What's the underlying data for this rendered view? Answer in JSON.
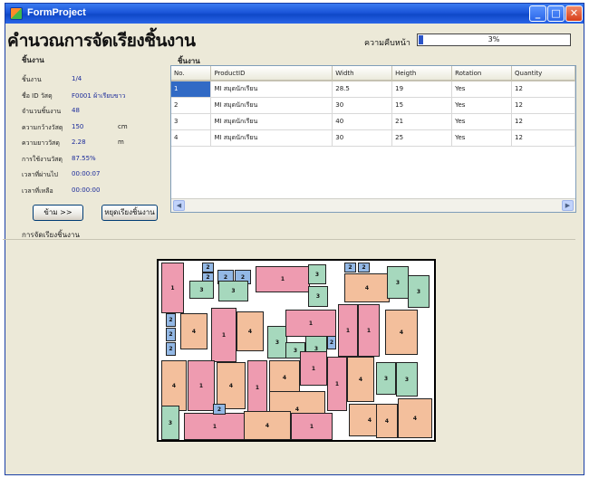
{
  "window": {
    "title": "FormProject"
  },
  "page_title": "คำนวณการจัดเรียงชิ้นงาน",
  "progress": {
    "label": "ความคืบหน้า",
    "value_text": "3%",
    "fraction": 0.03
  },
  "details": {
    "group_label": "ชิ้นงาน",
    "rows": [
      {
        "label": "ชิ้นงาน",
        "value": "1/4",
        "unit": ""
      },
      {
        "label": "ชื่อ ID วัสดุ",
        "value": "F0001 ผ้าเรียบขาว",
        "unit": ""
      },
      {
        "label": "จำนวนชิ้นงาน",
        "value": "48",
        "unit": ""
      },
      {
        "label": "ความกว้างวัสดุ",
        "value": "150",
        "unit": "cm"
      },
      {
        "label": "ความยาววัสดุ",
        "value": "2.28",
        "unit": "m"
      },
      {
        "label": "การใช้งานวัสดุ",
        "value": "87.55%",
        "unit": ""
      },
      {
        "label": "เวลาที่ผ่านไป",
        "value": "00:00:07",
        "unit": ""
      },
      {
        "label": "เวลาที่เหลือ",
        "value": "00:00:00",
        "unit": ""
      }
    ]
  },
  "buttons": {
    "next": "ข้าม >>",
    "stop": "หยุดเรียงชิ้นงาน"
  },
  "table": {
    "group_label": "ชิ้นงาน",
    "headers": [
      "No.",
      "ProductID",
      "Width",
      "Heigth",
      "Rotation",
      "Quantity"
    ],
    "rows": [
      [
        "1",
        "MI สมุดนักเรียน",
        "28.5",
        "19",
        "Yes",
        "12"
      ],
      [
        "2",
        "MI สมุดนักเรียน",
        "30",
        "15",
        "Yes",
        "12"
      ],
      [
        "3",
        "MI สมุดนักเรียน",
        "40",
        "21",
        "Yes",
        "12"
      ],
      [
        "4",
        "MI สมุดนักเรียน",
        "30",
        "25",
        "Yes",
        "12"
      ]
    ]
  },
  "layout": {
    "label": "การจัดเรียงชิ้นงาน",
    "colors": {
      "type1": "#ee9bb0",
      "type2": "#93b8e5",
      "type3": "#a6d8bd",
      "type4": "#f3bf9c"
    }
  }
}
